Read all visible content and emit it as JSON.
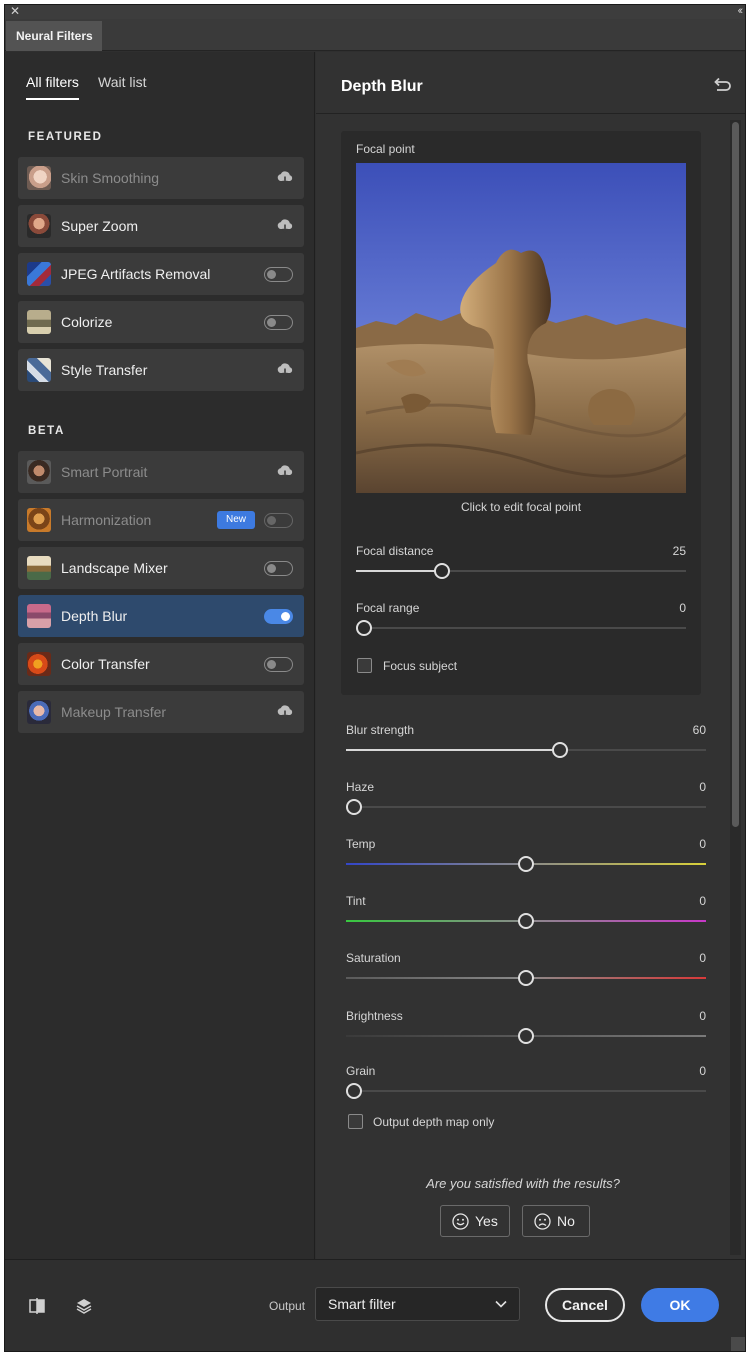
{
  "window": {
    "tab": "Neural Filters"
  },
  "left": {
    "tabs": [
      {
        "label": "All filters",
        "active": true
      },
      {
        "label": "Wait list",
        "active": false
      }
    ],
    "featured_title": "FEATURED",
    "beta_title": "BETA",
    "featured": [
      {
        "name": "Skin Smoothing",
        "control": "cloud",
        "dim": true
      },
      {
        "name": "Super Zoom",
        "control": "cloud",
        "dim": false
      },
      {
        "name": "JPEG Artifacts Removal",
        "control": "toggle-off",
        "dim": false
      },
      {
        "name": "Colorize",
        "control": "toggle-off",
        "dim": false
      },
      {
        "name": "Style Transfer",
        "control": "cloud",
        "dim": false
      }
    ],
    "beta": [
      {
        "name": "Smart Portrait",
        "control": "cloud",
        "dim": true
      },
      {
        "name": "Harmonization",
        "control": "toggle-off",
        "dim": true,
        "badge": "New"
      },
      {
        "name": "Landscape Mixer",
        "control": "toggle-off",
        "dim": false
      },
      {
        "name": "Depth Blur",
        "control": "toggle-on",
        "dim": false,
        "selected": true
      },
      {
        "name": "Color Transfer",
        "control": "toggle-off",
        "dim": false
      },
      {
        "name": "Makeup Transfer",
        "control": "cloud",
        "dim": true
      }
    ]
  },
  "panel": {
    "title": "Depth Blur",
    "focal_point_label": "Focal point",
    "focal_caption": "Click to edit focal point",
    "focal_distance": {
      "label": "Focal distance",
      "value": "25",
      "fraction": 0.26
    },
    "focal_range": {
      "label": "Focal range",
      "value": "0",
      "fraction": 0.0
    },
    "focus_subject": {
      "label": "Focus subject",
      "checked": false
    },
    "sliders": [
      {
        "key": "blur",
        "label": "Blur strength",
        "value": "60",
        "fraction": 0.595
      },
      {
        "key": "haze",
        "label": "Haze",
        "value": "0",
        "fraction": 0.0
      },
      {
        "key": "temp",
        "label": "Temp",
        "value": "0",
        "fraction": 0.5
      },
      {
        "key": "tint",
        "label": "Tint",
        "value": "0",
        "fraction": 0.5
      },
      {
        "key": "saturation",
        "label": "Saturation",
        "value": "0",
        "fraction": 0.5
      },
      {
        "key": "brightness",
        "label": "Brightness",
        "value": "0",
        "fraction": 0.5
      },
      {
        "key": "grain",
        "label": "Grain",
        "value": "0",
        "fraction": 0.0
      }
    ],
    "output_depth": {
      "label": "Output depth map only",
      "checked": false
    },
    "question": "Are you satisfied with the results?",
    "yes": "Yes",
    "no": "No"
  },
  "footer": {
    "output_label": "Output",
    "output_value": "Smart filter",
    "cancel": "Cancel",
    "ok": "OK"
  },
  "colors": {
    "accent": "#3f7be5",
    "selected_row": "#2e4a6d",
    "badge": "#3d7ae0"
  }
}
